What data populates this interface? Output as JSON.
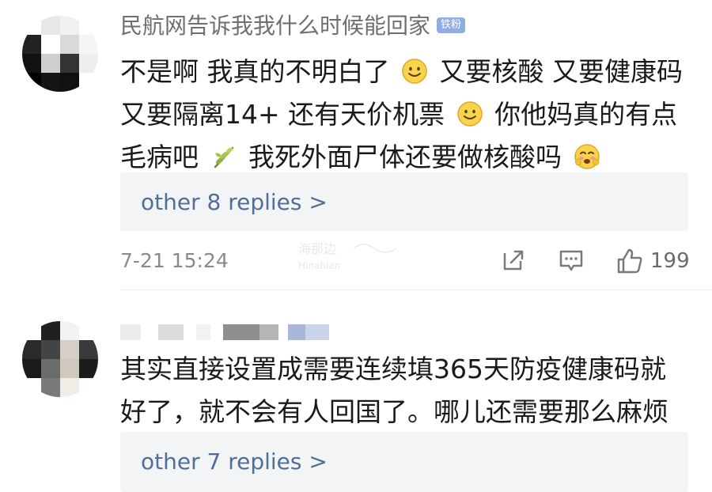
{
  "comments": [
    {
      "username": "民航网告诉我我什么时候能回家",
      "badge": "铁粉",
      "text": {
        "part1": "不是啊 我真的不明白了",
        "part2": "又要核酸 又要健康码 又要隔离14+ 还有天价机票",
        "part3": "你他妈真的有点毛病吧",
        "part4": "我死外面尸体还要做核酸吗"
      },
      "emojis": [
        "smile-emoji",
        "smile-emoji",
        "sprout-emoji",
        "shy-emoji"
      ],
      "replies_label": "other 8 replies >",
      "timestamp": "7-21 15:24",
      "watermark": "海那边\nHinabian",
      "like_count": "199",
      "icons": [
        "share-icon",
        "comment-icon",
        "like-icon"
      ]
    },
    {
      "username_redacted": true,
      "text": {
        "full": "其实直接设置成需要连续填365天防疫健康码就好了，就不会有人回国了。哪儿还需要那么麻烦"
      },
      "replies_label": "other 7 replies >"
    }
  ],
  "colors": {
    "username": "#6f6f6f",
    "badge_bg": "#8eaee3",
    "link": "#4f6f99",
    "replies_bg": "#f3f4f6",
    "meta": "#8a8a8a"
  }
}
